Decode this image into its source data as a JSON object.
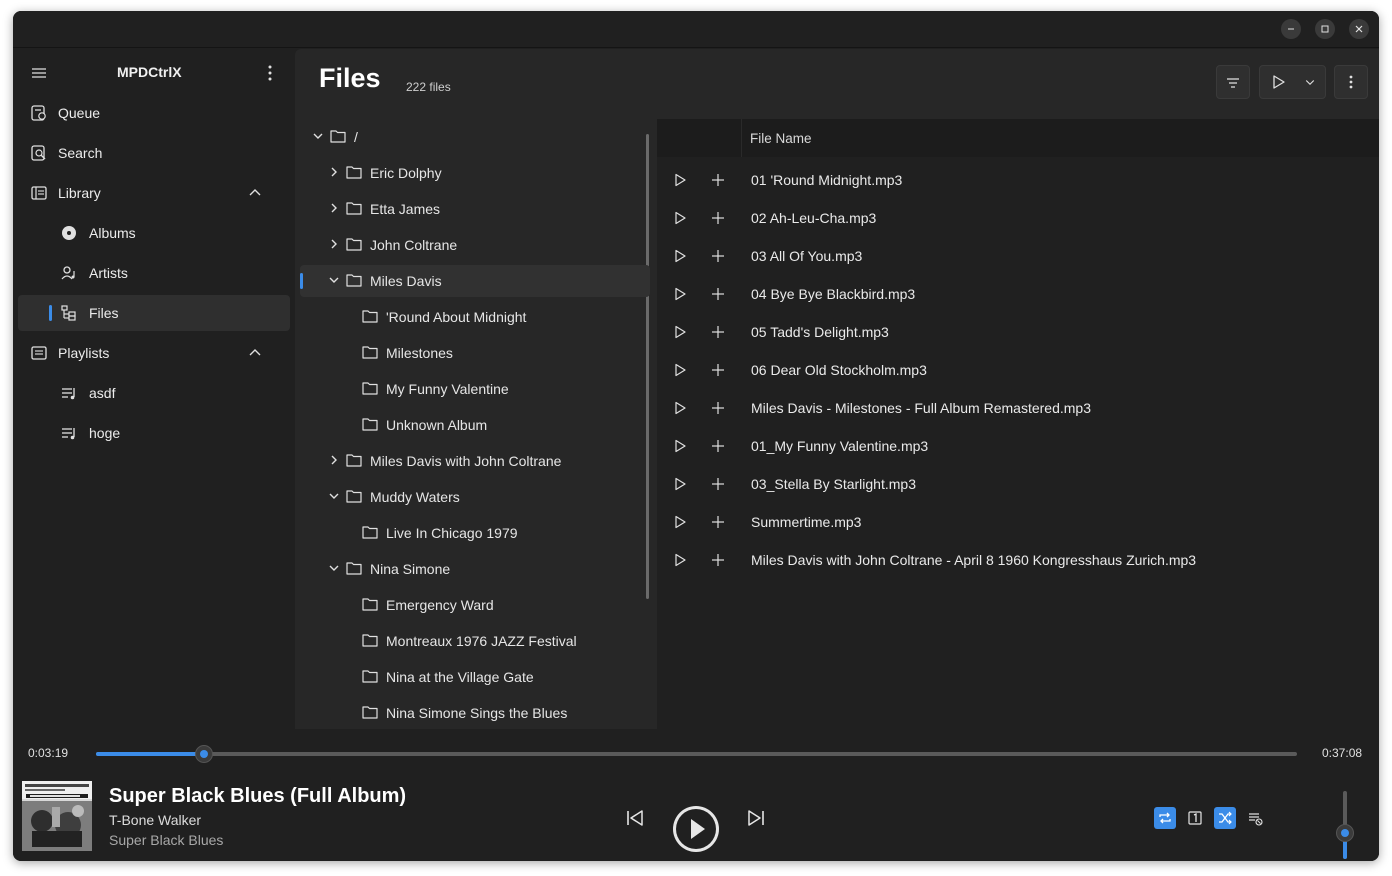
{
  "app": {
    "title": "MPDCtrlX"
  },
  "sidebar": {
    "items": [
      {
        "label": "Queue",
        "icon": "queue-icon"
      },
      {
        "label": "Search",
        "icon": "search-icon"
      },
      {
        "label": "Library",
        "icon": "library-icon",
        "expanded": true
      },
      {
        "label": "Albums",
        "icon": "album-icon"
      },
      {
        "label": "Artists",
        "icon": "artist-icon"
      },
      {
        "label": "Files",
        "icon": "file-tree-icon",
        "selected": true
      },
      {
        "label": "Playlists",
        "icon": "playlists-icon",
        "expanded": true
      },
      {
        "label": "asdf",
        "icon": "playlist-icon"
      },
      {
        "label": "hoge",
        "icon": "playlist-icon"
      }
    ]
  },
  "page": {
    "title": "Files",
    "count": "222 files"
  },
  "tree": {
    "nodes": [
      {
        "name": "/",
        "level": 0,
        "chevron": "down"
      },
      {
        "name": "Eric Dolphy",
        "level": 1,
        "chevron": "right"
      },
      {
        "name": "Etta James",
        "level": 1,
        "chevron": "right"
      },
      {
        "name": "John Coltrane",
        "level": 1,
        "chevron": "right"
      },
      {
        "name": "Miles Davis",
        "level": 1,
        "chevron": "down",
        "selected": true
      },
      {
        "name": "'Round About Midnight",
        "level": 2,
        "chevron": "none"
      },
      {
        "name": "Milestones",
        "level": 2,
        "chevron": "none"
      },
      {
        "name": "My Funny Valentine",
        "level": 2,
        "chevron": "none"
      },
      {
        "name": "Unknown Album",
        "level": 2,
        "chevron": "none"
      },
      {
        "name": "Miles Davis with John Coltrane",
        "level": 1,
        "chevron": "right"
      },
      {
        "name": "Muddy Waters",
        "level": 1,
        "chevron": "down"
      },
      {
        "name": "Live In Chicago 1979",
        "level": 2,
        "chevron": "none"
      },
      {
        "name": "Nina Simone",
        "level": 1,
        "chevron": "down"
      },
      {
        "name": "Emergency Ward",
        "level": 2,
        "chevron": "none"
      },
      {
        "name": "Montreaux 1976 JAZZ Festival",
        "level": 2,
        "chevron": "none"
      },
      {
        "name": "Nina at the Village Gate",
        "level": 2,
        "chevron": "none"
      },
      {
        "name": "Nina Simone Sings the Blues",
        "level": 2,
        "chevron": "none"
      }
    ]
  },
  "files": {
    "column_header": "File Name",
    "rows": [
      "01 'Round Midnight.mp3",
      "02 Ah-Leu-Cha.mp3",
      "03 All Of You.mp3",
      "04 Bye Bye Blackbird.mp3",
      "05 Tadd's Delight.mp3",
      "06 Dear Old Stockholm.mp3",
      "Miles Davis - Milestones - Full Album Remastered.mp3",
      "01_My Funny Valentine.mp3",
      "03_Stella By Starlight.mp3",
      "Summertime.mp3",
      "Miles Davis with John Coltrane - April 8 1960 Kongresshaus Zurich.mp3"
    ]
  },
  "player": {
    "elapsed": "0:03:19",
    "total": "0:37:08",
    "progress": 0.09,
    "volume": 0.38,
    "title": "Super Black Blues (Full Album)",
    "artist": "T-Bone Walker",
    "album": "Super Black Blues",
    "repeat": true,
    "single": false,
    "random": true,
    "consume": false
  },
  "colors": {
    "accent": "#3b8ce8",
    "background": "#202020",
    "content": "#272727"
  }
}
